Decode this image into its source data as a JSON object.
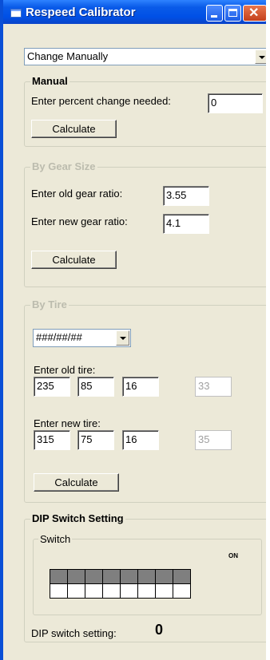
{
  "window": {
    "title": "Respeed Calibrator",
    "controls": {
      "minimize": "minimize-icon",
      "maximize": "maximize-icon",
      "close": "close-icon"
    }
  },
  "mode_select": {
    "value": "Change Manually"
  },
  "manual": {
    "legend": "Manual",
    "percent_label": "Enter percent change needed:",
    "percent_value": "0",
    "calculate_label": "Calculate"
  },
  "by_gear": {
    "legend": "By Gear Size",
    "old_label": "Enter old gear ratio:",
    "old_value": "3.55",
    "new_label": "Enter new gear ratio:",
    "new_value": "4.1",
    "calculate_label": "Calculate"
  },
  "by_tire": {
    "legend": "By Tire",
    "format_value": "###/##/##",
    "old_label": "Enter old tire:",
    "old_values": [
      "235",
      "85",
      "16"
    ],
    "old_diameter": "33",
    "new_label": "Enter new tire:",
    "new_values": [
      "315",
      "75",
      "16"
    ],
    "new_diameter": "35",
    "calculate_label": "Calculate"
  },
  "dip": {
    "legend": "DIP Switch Setting",
    "switch_legend": "Switch",
    "on_label": "ON",
    "switch_count": 8,
    "setting_label": "DIP switch setting:",
    "setting_value": "0"
  }
}
